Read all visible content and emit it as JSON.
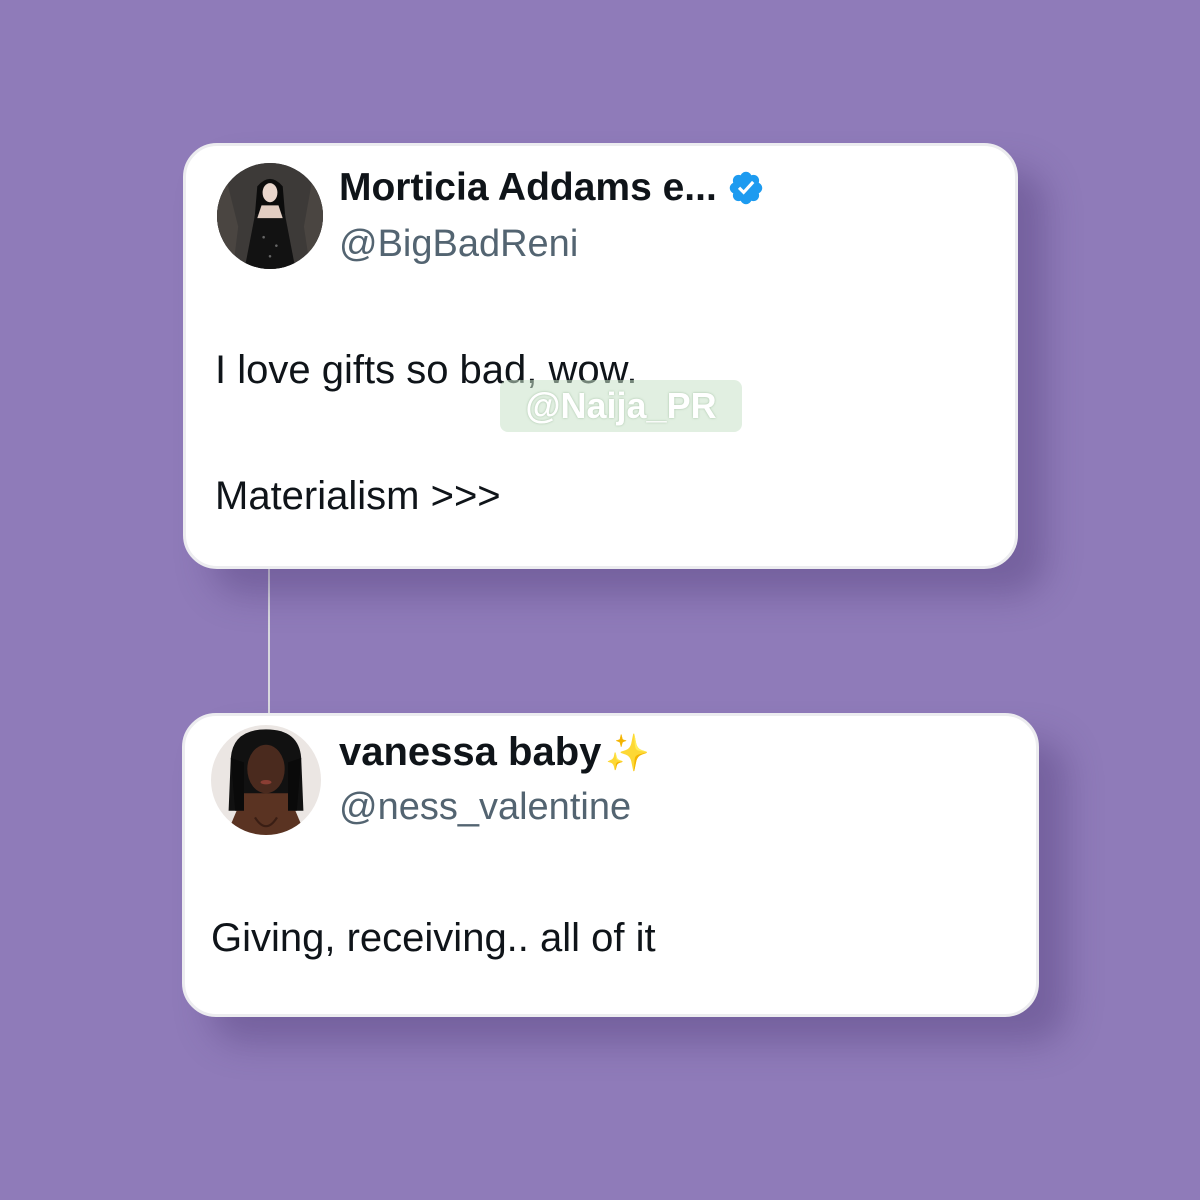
{
  "colors": {
    "background": "#8f7bb9",
    "card": "#ffffff",
    "name_text": "#0f1419",
    "handle_text": "#536471",
    "verified_badge": "#1d9bf0"
  },
  "tweet": {
    "author_name": "Morticia Addams e...",
    "handle": "@BigBadReni",
    "verified": true,
    "avatar_icon": "avatar-gothic-woman",
    "text_line1": "I love gifts so bad, wow.",
    "text_line2": "Materialism >>>"
  },
  "reply": {
    "author_name": "vanessa baby",
    "name_emoji": "✨",
    "handle": "@ness_valentine",
    "avatar_icon": "avatar-woman",
    "text": "Giving, receiving.. all of it"
  },
  "watermark": "@Naija_PR"
}
